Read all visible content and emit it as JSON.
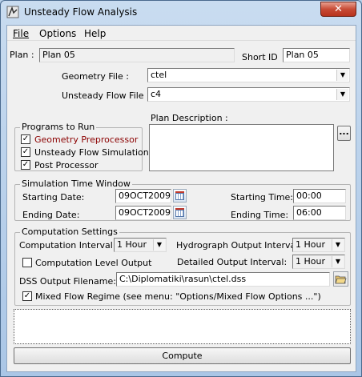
{
  "window": {
    "title": "Unsteady Flow Analysis",
    "close_glyph": "✕"
  },
  "menu": {
    "file": "File",
    "options": "Options",
    "help": "Help"
  },
  "plan": {
    "label": "Plan :",
    "value": "Plan 05",
    "short_id_label": "Short ID",
    "short_id_value": "Plan 05"
  },
  "geometry": {
    "label": "Geometry File :",
    "value": "ctel"
  },
  "unsteady": {
    "label": "Unsteady Flow File :",
    "value": "c4"
  },
  "programs": {
    "title": "Programs to Run",
    "items": [
      {
        "label": "Geometry Preprocessor",
        "checked": true,
        "color": "#8b0000"
      },
      {
        "label": "Unsteady Flow Simulation",
        "checked": true
      },
      {
        "label": "Post Processor",
        "checked": true
      }
    ]
  },
  "description": {
    "label": "Plan Description :",
    "button": "..."
  },
  "sim_window": {
    "title": "Simulation Time Window",
    "start_date_label": "Starting Date:",
    "start_date": "09OCT2009",
    "end_date_label": "Ending Date:",
    "end_date": "09OCT2009",
    "start_time_label": "Starting Time:",
    "start_time": "00:00",
    "end_time_label": "Ending Time:",
    "end_time": "06:00"
  },
  "comp": {
    "title": "Computation Settings",
    "interval_label": "Computation Interval:",
    "interval": "1 Hour",
    "hydro_label": "Hydrograph Output Interval:",
    "hydro": "1 Hour",
    "level_label": "Computation Level Output",
    "level_checked": false,
    "detailed_label": "Detailed Output Interval:",
    "detailed": "1 Hour",
    "dss_label": "DSS Output Filename:",
    "dss": "C:\\Diplomatiki\\rasun\\ctel.dss",
    "mixed_label": "Mixed Flow Regime (see menu: \"Options/Mixed Flow Options ...\")",
    "mixed_checked": true
  },
  "compute_label": "Compute",
  "check_glyph": "✓",
  "arrow_glyph": "▼"
}
